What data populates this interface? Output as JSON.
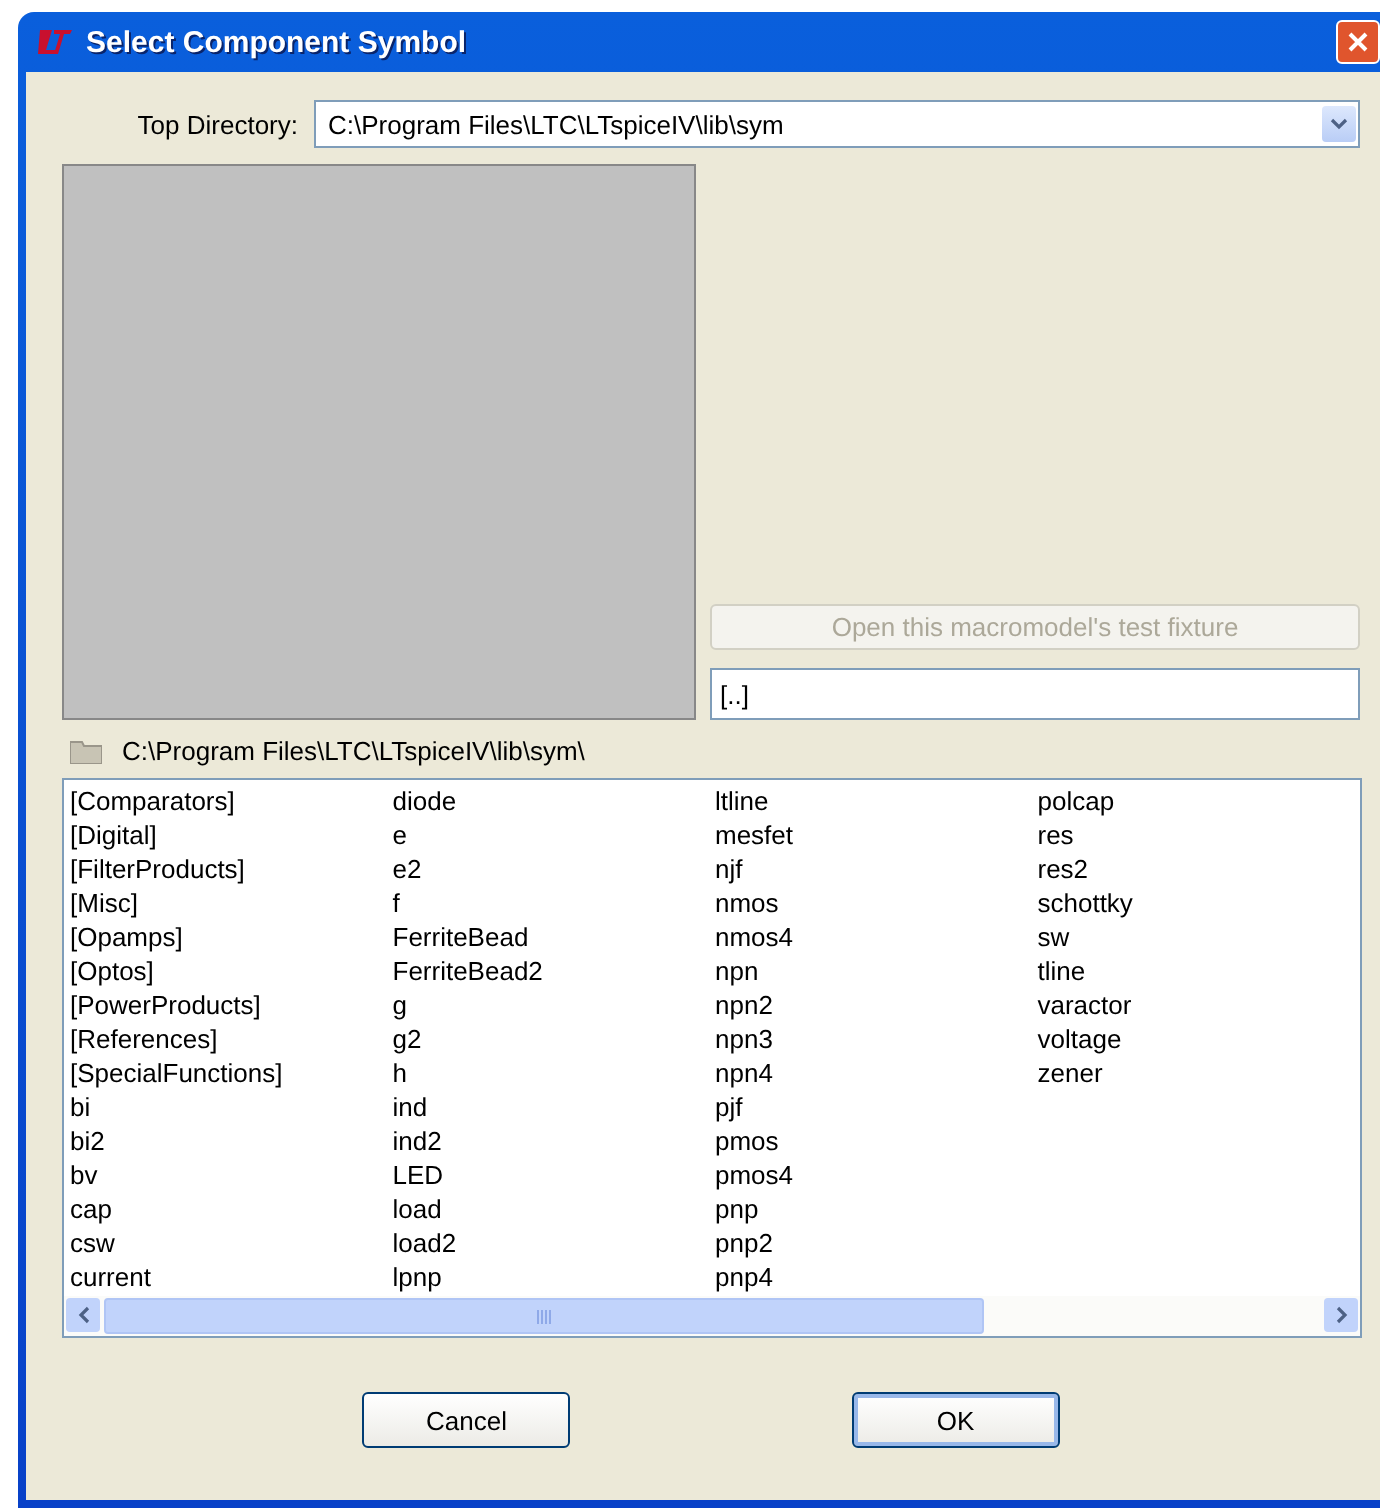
{
  "window": {
    "title": "Select Component Symbol"
  },
  "top_directory": {
    "label": "Top Directory:",
    "value": "C:\\Program Files\\LTC\\LTspiceIV\\lib\\sym"
  },
  "test_fixture_button": {
    "label": "Open this macromodel's test fixture",
    "disabled": true
  },
  "name_field": {
    "value": "[..]"
  },
  "current_path": "C:\\Program Files\\LTC\\LTspiceIV\\lib\\sym\\",
  "file_list": {
    "columns": [
      [
        "[Comparators]",
        "[Digital]",
        "[FilterProducts]",
        "[Misc]",
        "[Opamps]",
        "[Optos]",
        "[PowerProducts]",
        "[References]",
        "[SpecialFunctions]",
        "bi",
        "bi2",
        "bv",
        "cap",
        "csw",
        "current"
      ],
      [
        "diode",
        "e",
        "e2",
        "f",
        "FerriteBead",
        "FerriteBead2",
        "g",
        "g2",
        "h",
        "ind",
        "ind2",
        "LED",
        "load",
        "load2",
        "lpnp"
      ],
      [
        "ltline",
        "mesfet",
        "njf",
        "nmos",
        "nmos4",
        "npn",
        "npn2",
        "npn3",
        "npn4",
        "pjf",
        "pmos",
        "pmos4",
        "pnp",
        "pnp2",
        "pnp4"
      ],
      [
        "polcap",
        "res",
        "res2",
        "schottky",
        "sw",
        "tline",
        "varactor",
        "voltage",
        "zener"
      ]
    ]
  },
  "buttons": [
    {
      "label": "Cancel",
      "default": false
    },
    {
      "label": "OK",
      "default": true
    }
  ]
}
